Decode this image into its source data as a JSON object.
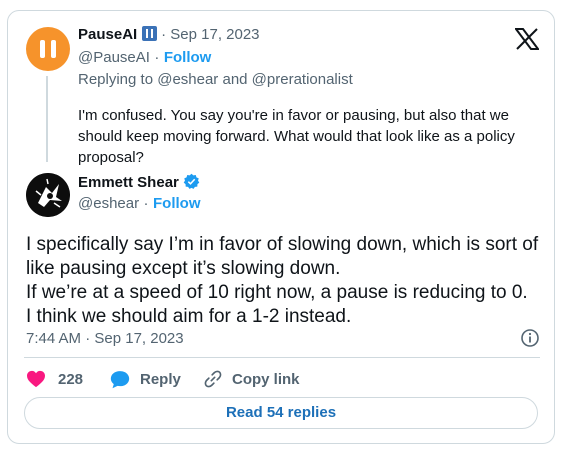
{
  "reply_tweet": {
    "name": "PauseAI",
    "date": "· Sep 17, 2023",
    "handle": "@PauseAI",
    "follow": "Follow",
    "dot": "·",
    "replying_to": "Replying to @eshear and @prerationalist",
    "text": "I'm confused. You say you're in favor or pausing, but also that we should keep moving forward. What would that look like as a policy proposal?"
  },
  "main_tweet": {
    "name": "Emmett Shear",
    "handle": "@eshear",
    "dot": "·",
    "follow": "Follow",
    "text_line1": "I specifically say I’m in favor of slowing down, which is sort of like pausing except it’s slowing down.",
    "text_line2": "If we’re at a speed of 10 right now, a pause is reducing to 0.",
    "text_line3": "I think we should aim for a 1-2 instead.",
    "timestamp": "7:44 AM · Sep 17, 2023"
  },
  "actions": {
    "likes": "228",
    "reply": "Reply",
    "copy_link": "Copy link",
    "read_replies": "Read 54 replies"
  },
  "icons": [
    "x-logo-icon",
    "pause-badge-icon",
    "verified-icon",
    "info-icon",
    "heart-icon",
    "reply-bubble-icon",
    "link-icon"
  ],
  "colors": {
    "accent": "#1d9bf0",
    "like": "#f91880",
    "pause_avatar": "#f6932b"
  }
}
